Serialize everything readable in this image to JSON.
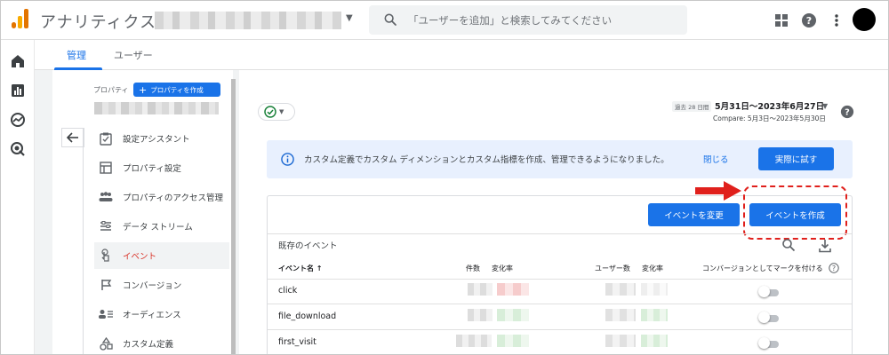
{
  "app": {
    "title": "アナリティクス"
  },
  "search": {
    "placeholder": "「ユーザーを追加」と検索してみてください"
  },
  "tabs": [
    {
      "label": "管理"
    },
    {
      "label": "ユーザー"
    }
  ],
  "sidebar": {
    "property_label": "プロパティ",
    "create_property_label": "プロパティを作成",
    "items": [
      {
        "label": "設定アシスタント",
        "icon": "checklist-icon"
      },
      {
        "label": "プロパティ設定",
        "icon": "layout-icon"
      },
      {
        "label": "プロパティのアクセス管理",
        "icon": "people-icon"
      },
      {
        "label": "データ ストリーム",
        "icon": "streams-icon"
      },
      {
        "label": "イベント",
        "icon": "touch-icon",
        "active": true
      },
      {
        "label": "コンバージョン",
        "icon": "flag-icon"
      },
      {
        "label": "オーディエンス",
        "icon": "audience-icon"
      },
      {
        "label": "カスタム定義",
        "icon": "shapes-icon"
      }
    ]
  },
  "date": {
    "chip": "過去 28 日間",
    "range": "5月31日〜2023年6月27日",
    "compare": "Compare: 5月3日〜2023年5月30日"
  },
  "banner": {
    "text": "カスタム定義でカスタム ディメンションとカスタム指標を作成、管理できるようになりました。",
    "close": "閉じる",
    "try": "実際に試す"
  },
  "events": {
    "modify_button": "イベントを変更",
    "create_button": "イベントを作成",
    "section_title": "既存のイベント",
    "columns": {
      "name": "イベント名 ↑",
      "count": "件数",
      "change1": "変化率",
      "users": "ユーザー数",
      "change2": "変化率",
      "conversion": "コンバージョンとしてマークを付ける"
    },
    "rows": [
      {
        "name": "click",
        "conversion": false
      },
      {
        "name": "file_download",
        "conversion": false
      },
      {
        "name": "first_visit",
        "conversion": false
      }
    ]
  },
  "colors": {
    "accent": "#1a73e8",
    "active_nav": "#d93025",
    "annotation": "#e0201c",
    "logo": "#f9ab00"
  }
}
